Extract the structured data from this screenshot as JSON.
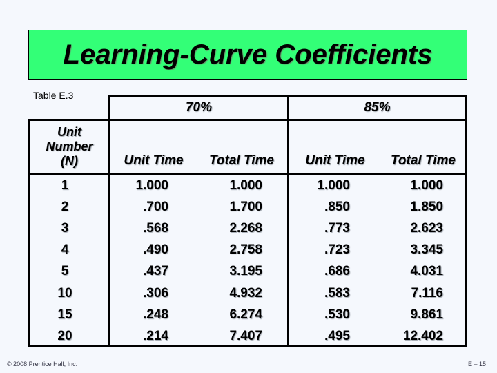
{
  "slide": {
    "title": "Learning-Curve Coefficients",
    "table_label": "Table E.3",
    "footer_copyright": "© 2008 Prentice Hall, Inc.",
    "page_number": "E – 15"
  },
  "table": {
    "group_headers": [
      "70%",
      "85%"
    ],
    "col_unit_number": "Unit Number (N)",
    "col_unit_number_lines": [
      "Unit",
      "Number",
      "(N)"
    ],
    "sub_headers": [
      "Unit Time",
      "Total Time",
      "Unit Time",
      "Total Time"
    ],
    "rows": [
      {
        "n": "1",
        "u70": "1.000",
        "t70": "1.000",
        "u85": "1.000",
        "t85": "1.000"
      },
      {
        "n": "2",
        "u70": ".700",
        "t70": "1.700",
        "u85": ".850",
        "t85": "1.850"
      },
      {
        "n": "3",
        "u70": ".568",
        "t70": "2.268",
        "u85": ".773",
        "t85": "2.623"
      },
      {
        "n": "4",
        "u70": ".490",
        "t70": "2.758",
        "u85": ".723",
        "t85": "3.345"
      },
      {
        "n": "5",
        "u70": ".437",
        "t70": "3.195",
        "u85": ".686",
        "t85": "4.031"
      },
      {
        "n": "10",
        "u70": ".306",
        "t70": "4.932",
        "u85": ".583",
        "t85": "7.116"
      },
      {
        "n": "15",
        "u70": ".248",
        "t70": "6.274",
        "u85": ".530",
        "t85": "9.861"
      },
      {
        "n": "20",
        "u70": ".214",
        "t70": "7.407",
        "u85": ".495",
        "t85": "12.402"
      }
    ]
  },
  "colors": {
    "title_background": "#33ff77",
    "page_background": "#f5f8fd"
  }
}
